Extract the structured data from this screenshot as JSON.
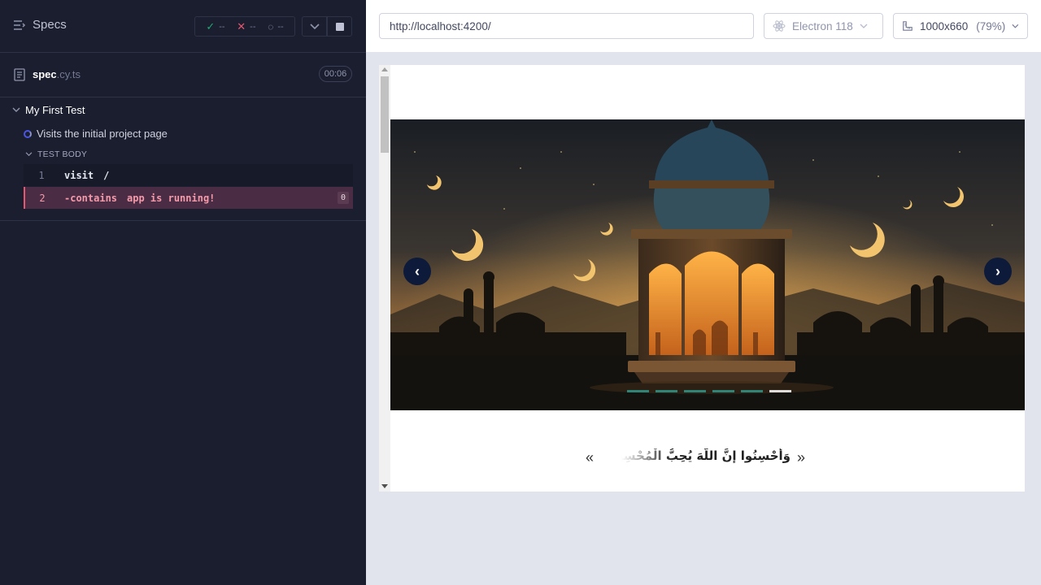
{
  "reporter": {
    "specs_label": "Specs",
    "stats": {
      "passed": "--",
      "failed": "--",
      "pending": "--"
    },
    "spec": {
      "name": "spec",
      "ext": ".cy.ts",
      "duration": "00:06"
    },
    "suite_title": "My First Test",
    "test_title": "Visits the initial project page",
    "test_body_label": "TEST BODY",
    "commands": [
      {
        "number": "1",
        "name": "visit",
        "message": "/"
      },
      {
        "number": "2",
        "name": "-contains",
        "message": "app is running!",
        "badge": "0"
      }
    ]
  },
  "aut": {
    "url": "http://localhost:4200/",
    "browser": "Electron 118",
    "viewport": "1000x660",
    "scale": "(79%)",
    "carousel": {
      "prev": "‹",
      "next": "›",
      "indicator_count": 6,
      "active_index": 5
    },
    "marquee": {
      "text": "وَأَحْسِنُوا إِنَّ اللَّهَ يُحِبُّ الْمُحْسِنِينَ",
      "left_arrow": "«",
      "right_arrow": "»"
    }
  },
  "colors": {
    "reporter_bg": "#1b1e2e",
    "fail": "#e45770",
    "pass": "#1fa971",
    "aut_bg": "#e1e3ed"
  }
}
